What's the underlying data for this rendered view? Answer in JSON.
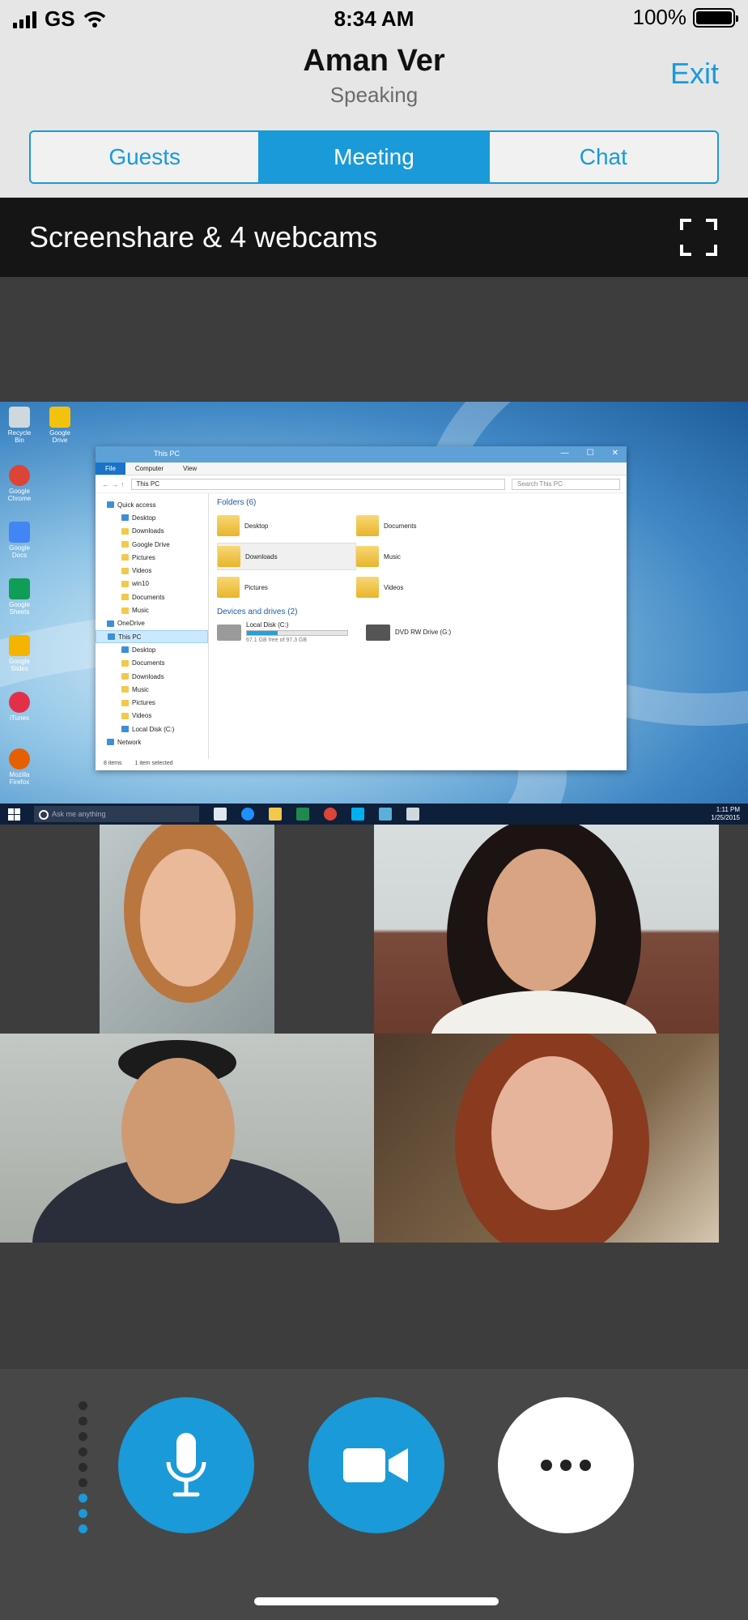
{
  "status_bar": {
    "carrier": "GS",
    "time": "8:34 AM",
    "battery": "100%"
  },
  "header": {
    "speaker_name": "Aman Ver",
    "speaker_status": "Speaking",
    "exit_label": "Exit"
  },
  "tabs": [
    {
      "label": "Guests",
      "active": false
    },
    {
      "label": "Meeting",
      "active": true
    },
    {
      "label": "Chat",
      "active": false
    }
  ],
  "share": {
    "title": "Screenshare & 4 webcams"
  },
  "desktop": {
    "icons": [
      "Recycle Bin",
      "Google Drive",
      "Google Chrome",
      "Google Docs",
      "Google Sheets",
      "Google Slides",
      "iTunes",
      "Mozilla Firefox"
    ],
    "explorer": {
      "title": "This PC",
      "ribbon": [
        "File",
        "Computer",
        "View"
      ],
      "address": "This PC",
      "search_placeholder": "Search This PC",
      "nav": [
        "Quick access",
        "Desktop",
        "Downloads",
        "Google Drive",
        "Pictures",
        "Videos",
        "win10",
        "Documents",
        "Music",
        "OneDrive",
        "This PC",
        "Desktop",
        "Documents",
        "Downloads",
        "Music",
        "Pictures",
        "Videos",
        "Local Disk (C:)",
        "Network"
      ],
      "folders_heading": "Folders (6)",
      "folders": [
        "Desktop",
        "Documents",
        "Downloads",
        "Music",
        "Pictures",
        "Videos"
      ],
      "drives_heading": "Devices and drives (2)",
      "drives": [
        {
          "name": "Local Disk (C:)",
          "detail": "67.1 GB free of 97.3 GB",
          "used_fraction": 0.31
        },
        {
          "name": "DVD RW Drive (G:)",
          "detail": ""
        }
      ],
      "status_items": "8 items",
      "status_selected": "1 item selected"
    },
    "taskbar": {
      "search_placeholder": "Ask me anything",
      "time": "1:11 PM",
      "date": "1/25/2015"
    }
  },
  "controls": {
    "mic_icon": "microphone-icon",
    "video_icon": "video-camera-icon",
    "more_icon": "more-icon",
    "audio_level": 3
  }
}
